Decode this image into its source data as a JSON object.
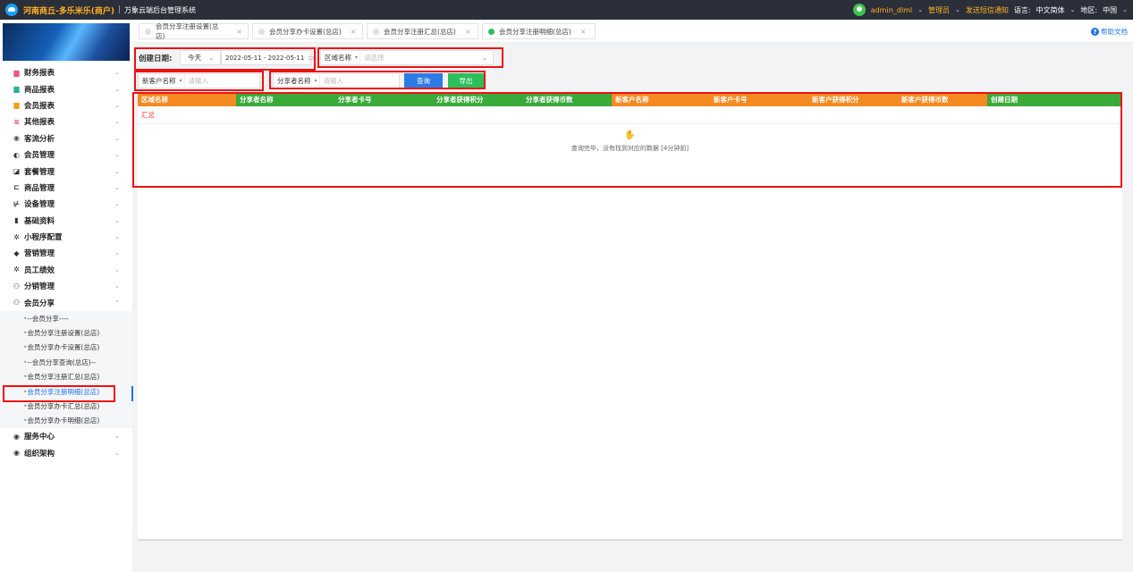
{
  "topbar": {
    "brand": "河南商丘-多乐米乐(商户)",
    "separator": "|",
    "subtitle": "万象云端后台管理系统",
    "user": "admin_dlml",
    "role": "管理员",
    "sms": "发送短信通知",
    "lang_label": "语言:",
    "lang_value": "中文简体",
    "region_label": "地区:",
    "region_value": "中国"
  },
  "sidebar": {
    "items": [
      {
        "label": "财务报表",
        "icon": "finance-icon",
        "glyph": "▆",
        "color": "#e85c7a"
      },
      {
        "label": "商品报表",
        "icon": "goods-report-icon",
        "glyph": "▆",
        "color": "#2bb0a0"
      },
      {
        "label": "会员报表",
        "icon": "member-report-icon",
        "glyph": "▆",
        "color": "#f0a020"
      },
      {
        "label": "其他报表",
        "icon": "layers-icon",
        "glyph": "≋",
        "color": "#e84040"
      },
      {
        "label": "客流分析",
        "icon": "target-icon",
        "glyph": "◉",
        "color": "#555"
      },
      {
        "label": "会员管理",
        "icon": "member-icon",
        "glyph": "◐",
        "color": "#333"
      },
      {
        "label": "套餐管理",
        "icon": "package-icon",
        "glyph": "◪",
        "color": "#333"
      },
      {
        "label": "商品管理",
        "icon": "goods-icon",
        "glyph": "⊏",
        "color": "#333"
      },
      {
        "label": "设备管理",
        "icon": "device-icon",
        "glyph": "⊬",
        "color": "#333"
      },
      {
        "label": "基础资料",
        "icon": "document-icon",
        "glyph": "▮",
        "color": "#333"
      },
      {
        "label": "小程序配置",
        "icon": "gear-icon",
        "glyph": "✲",
        "color": "#333"
      },
      {
        "label": "营销管理",
        "icon": "tag-icon",
        "glyph": "◆",
        "color": "#333"
      },
      {
        "label": "员工绩效",
        "icon": "gear-icon",
        "glyph": "✲",
        "color": "#333"
      },
      {
        "label": "分销管理",
        "icon": "users-icon",
        "glyph": "⚇",
        "color": "#333"
      },
      {
        "label": "会员分享",
        "icon": "users-icon",
        "glyph": "⚇",
        "color": "#333"
      }
    ],
    "expanded_sub": [
      "--会员分享----",
      "会员分享注册设置(总店)",
      "会员分享办卡设置(总店)",
      "--会员分享查询(总店)--",
      "会员分享注册汇总(总店)",
      "会员分享注册明细(总店)",
      "会员分享办卡汇总(总店)",
      "会员分享办卡明细(总店)"
    ],
    "tail_items": [
      {
        "label": "服务中心",
        "icon": "service-icon",
        "glyph": "◉",
        "color": "#333"
      },
      {
        "label": "组织架构",
        "icon": "org-icon",
        "glyph": "◉",
        "color": "#333"
      }
    ]
  },
  "tabs": [
    {
      "label": "会员分享注册设置(总店)",
      "active": false
    },
    {
      "label": "会员分享办卡设置(总店)",
      "active": false
    },
    {
      "label": "会员分享注册汇总(总店)",
      "active": false
    },
    {
      "label": "会员分享注册明细(总店)",
      "active": true
    }
  ],
  "help": "帮助文档",
  "filters": {
    "date_label": "创建日期:",
    "date_preset": "今天",
    "date_range": "2022-05-11 - 2022-05-11",
    "region_label": "区域名称",
    "region_placeholder": "请选择",
    "new_customer_label": "新客户名称",
    "new_customer_placeholder": "请输入",
    "sharer_label": "分享者名称",
    "sharer_placeholder": "请输入",
    "query_button": "查询",
    "export_button": "导出"
  },
  "table": {
    "columns": [
      {
        "label": "区域名称",
        "color": "#f58a22"
      },
      {
        "label": "分享者名称",
        "color": "#3aaa3a"
      },
      {
        "label": "分享者卡号",
        "color": "#3aaa3a"
      },
      {
        "label": "分享者获得积分",
        "color": "#3aaa3a"
      },
      {
        "label": "分享者获得币数",
        "color": "#3aaa3a"
      },
      {
        "label": "新客户名称",
        "color": "#f58a22"
      },
      {
        "label": "新客户卡号",
        "color": "#f58a22"
      },
      {
        "label": "新客户获得积分",
        "color": "#f58a22"
      },
      {
        "label": "新客户获得币数",
        "color": "#f58a22"
      },
      {
        "label": "创建日期",
        "color": "#3aaa3a"
      }
    ],
    "summary_label": "汇总",
    "empty_message": "查询完毕，没有找到对应的数据 [4分钟前]"
  }
}
